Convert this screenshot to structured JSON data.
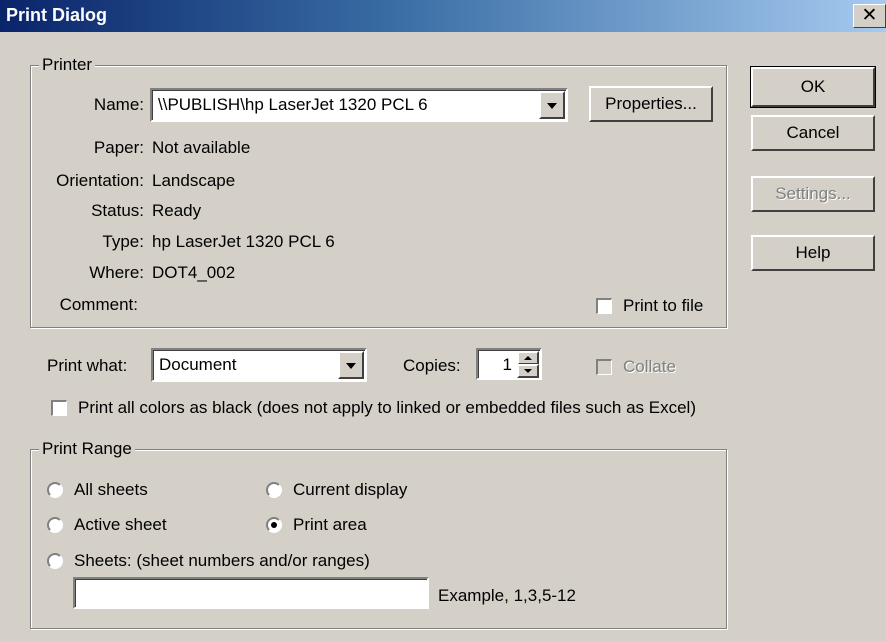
{
  "title": "Print Dialog",
  "close_glyph": "✕",
  "printer": {
    "legend": "Printer",
    "name_label": "Name:",
    "name_value": "\\\\PUBLISH\\hp LaserJet 1320 PCL 6",
    "properties_label": "Properties...",
    "paper_label": "Paper:",
    "paper_value": "Not available",
    "orientation_label": "Orientation:",
    "orientation_value": "Landscape",
    "status_label": "Status:",
    "status_value": "Ready",
    "type_label": "Type:",
    "type_value": "hp LaserJet 1320 PCL 6",
    "where_label": "Where:",
    "where_value": "DOT4_002",
    "comment_label": "Comment:",
    "comment_value": "",
    "print_to_file_label": "Print to file",
    "print_to_file_checked": false
  },
  "buttons": {
    "ok": "OK",
    "cancel": "Cancel",
    "settings": "Settings...",
    "help": "Help"
  },
  "options": {
    "print_what_label": "Print what:",
    "print_what_value": "Document",
    "copies_label": "Copies:",
    "copies_value": "1",
    "collate_label": "Collate",
    "collate_checked": false,
    "black_label": "Print all colors as black (does not apply to linked or embedded files such as Excel)",
    "black_checked": false
  },
  "range": {
    "legend": "Print Range",
    "all_sheets": "All sheets",
    "current_display": "Current display",
    "active_sheet": "Active sheet",
    "print_area": "Print area",
    "sheets": "Sheets: (sheet numbers and/or ranges)",
    "sheets_value": "",
    "example": "Example, 1,3,5-12",
    "selected": "print_area"
  }
}
